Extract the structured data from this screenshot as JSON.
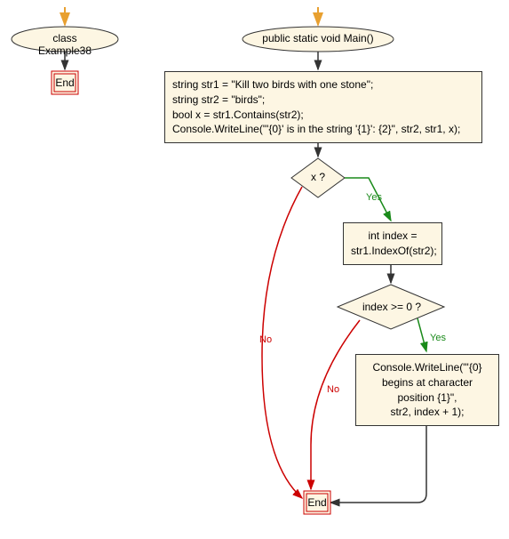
{
  "nodes": {
    "class_ellipse": "class Example38",
    "main_ellipse": "public static void Main()",
    "code_block1_line1": "string str1 = \"Kill two birds with one stone\";",
    "code_block1_line2": "string str2 = \"birds\";",
    "code_block1_line3": "bool x = str1.Contains(str2);",
    "code_block1_line4": "Console.WriteLine(\"'{0}' is in the string '{1}': {2}\", str2, str1, x);",
    "diamond1": "x ?",
    "code_block2_line1": "int index =",
    "code_block2_line2": "str1.IndexOf(str2);",
    "diamond2": "index >= 0 ?",
    "code_block3_line1": "Console.WriteLine(\"'{0}",
    "code_block3_line2": "begins at character",
    "code_block3_line3": "position {1}\",",
    "code_block3_line4": "str2, index + 1);",
    "end1": "End",
    "end2": "End"
  },
  "edges": {
    "yes1": "Yes",
    "no1": "No",
    "yes2": "Yes",
    "no2": "No"
  }
}
